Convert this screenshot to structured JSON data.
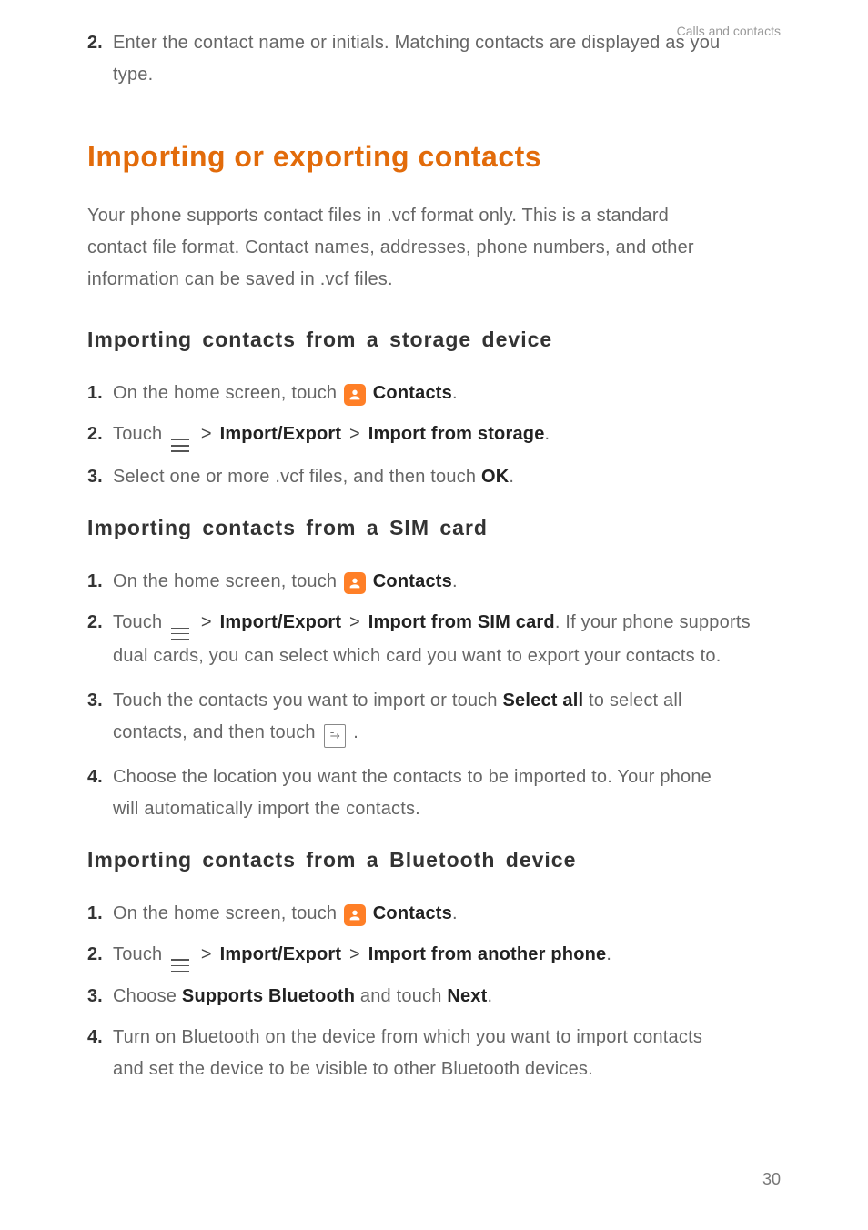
{
  "header": {
    "crumb": "Calls and contacts"
  },
  "top_step": {
    "num": "2.",
    "text_a": "Enter the contact name or initials. Matching contacts are displayed as you",
    "text_b": "type."
  },
  "h1": "Importing or exporting contacts",
  "lead_a": "Your phone supports contact files in .vcf format only. This is a standard",
  "lead_b": "contact file format. Contact names, addresses, phone numbers, and other",
  "lead_c": "information can be saved in .vcf files.",
  "sec1": {
    "title": "Importing contacts from a storage device",
    "s1": {
      "num": "1.",
      "pre": "On the home screen, touch ",
      "app": "Contacts",
      "post": "."
    },
    "s2": {
      "num": "2.",
      "pre": "Touch ",
      "m1": "Import/Export",
      "m2": "Import from storage",
      "post": "."
    },
    "s3": {
      "num": "3.",
      "pre": "Select one or more .vcf files, and then touch ",
      "ok": "OK",
      "post": "."
    }
  },
  "sec2": {
    "title": "Importing contacts from a SIM card",
    "s1": {
      "num": "1.",
      "pre": "On the home screen, touch ",
      "app": "Contacts",
      "post": "."
    },
    "s2": {
      "num": "2.",
      "pre": "Touch ",
      "m1": "Import/Export",
      "m2": "Import from SIM card",
      "tail1": ". If your phone supports",
      "tail2": "dual cards, you can select which card you want to export your contacts to."
    },
    "s3": {
      "num": "3.",
      "pre": "Touch the contacts you want to import or touch ",
      "sa": "Select all",
      "mid": " to select all",
      "line2a": "contacts, and then touch ",
      "line2b": " ."
    },
    "s4": {
      "num": "4.",
      "l1": "Choose the location you want the contacts to be imported to. Your phone",
      "l2": "will automatically import the contacts."
    }
  },
  "sec3": {
    "title": "Importing contacts from a Bluetooth device",
    "s1": {
      "num": "1.",
      "pre": "On the home screen, touch ",
      "app": "Contacts",
      "post": "."
    },
    "s2": {
      "num": "2.",
      "pre": "Touch ",
      "m1": "Import/Export",
      "m2": "Import from another phone",
      "post": "."
    },
    "s3": {
      "num": "3.",
      "pre": "Choose ",
      "sb": "Supports Bluetooth",
      "mid": " and touch ",
      "nx": "Next",
      "post": "."
    },
    "s4": {
      "num": "4.",
      "l1": "Turn on Bluetooth on the device from which you want to import contacts",
      "l2": "and set the device to be visible to other Bluetooth devices."
    }
  },
  "page": "30"
}
